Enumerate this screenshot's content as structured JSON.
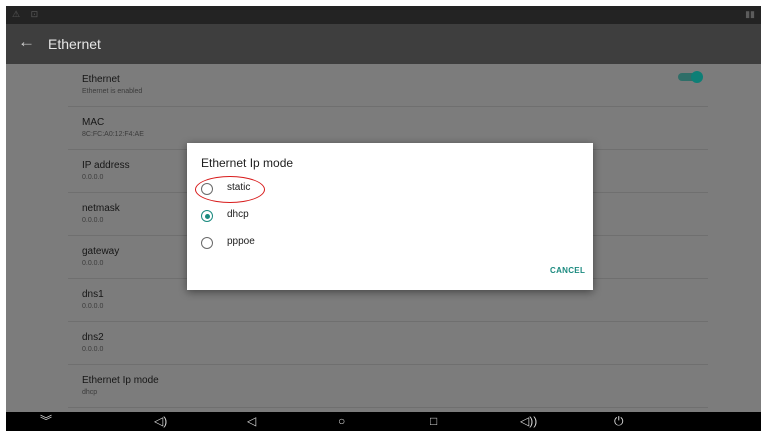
{
  "app": {
    "title": "Ethernet"
  },
  "settings": [
    {
      "title": "Ethernet",
      "subtitle": "Ethernet is enabled"
    },
    {
      "title": "MAC",
      "subtitle": "8C:FC:A0:12:F4:AE"
    },
    {
      "title": "IP address",
      "subtitle": "0.0.0.0"
    },
    {
      "title": "netmask",
      "subtitle": "0.0.0.0"
    },
    {
      "title": "gateway",
      "subtitle": "0.0.0.0"
    },
    {
      "title": "dns1",
      "subtitle": "0.0.0.0"
    },
    {
      "title": "dns2",
      "subtitle": "0.0.0.0"
    },
    {
      "title": "Ethernet Ip mode",
      "subtitle": "dhcp"
    }
  ],
  "toggle": {
    "enabled": true,
    "accent": "#0e7f76"
  },
  "dialog": {
    "title": "Ethernet Ip mode",
    "options": [
      {
        "label": "static",
        "checked": false
      },
      {
        "label": "dhcp",
        "checked": true
      },
      {
        "label": "pppoe",
        "checked": false
      }
    ],
    "cancel_label": "CANCEL",
    "accent": "#1b8a7f",
    "highlight_color": "#d81b1b"
  },
  "icons": {
    "back": "arrow-left",
    "nav": [
      "chevron-down",
      "volume-down",
      "back",
      "home",
      "recents",
      "volume-up",
      "power"
    ]
  }
}
